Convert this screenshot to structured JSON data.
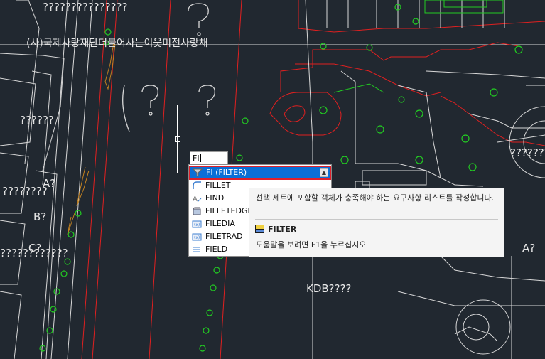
{
  "drawing": {
    "labels": {
      "top_question": "???????????????",
      "org_name": "(사)국제사랑재단더불어사는이웃미전사랑채",
      "left_q1": "??????",
      "left_a": "A?",
      "left_q2": "????????",
      "left_b": "B?",
      "left_c": "C?",
      "left_q3": "????????????",
      "right_q": "???????",
      "right_a": "A?",
      "kdb": "KDB????"
    },
    "colors": {
      "background": "#212830",
      "red": "#e02020",
      "green": "#22cc22",
      "white": "#e8e8e8",
      "orange": "#c08020"
    }
  },
  "command": {
    "input_value": "FI",
    "autocomplete": [
      {
        "label": "FI (FILTER)",
        "icon": "filter-icon",
        "selected": true
      },
      {
        "label": "FILLET",
        "icon": "fillet-icon",
        "selected": false
      },
      {
        "label": "FIND",
        "icon": "find-icon",
        "selected": false
      },
      {
        "label": "FILLETEDGE",
        "icon": "filletedge-icon",
        "selected": false
      },
      {
        "label": "FILEDIA",
        "icon": "filedia-icon",
        "selected": false
      },
      {
        "label": "FILETRAD",
        "icon": "filetrad-icon",
        "selected": false
      },
      {
        "label": "FIELD",
        "icon": "field-icon",
        "selected": false
      }
    ],
    "scroll_up_glyph": "▲"
  },
  "tooltip": {
    "description": "선택 세트에 포함할 객체가 충족해야 하는 요구사항 리스트를 작성합니다.",
    "command_name": "FILTER",
    "help_text": "도움말을 보려면 F1을 누르십시오"
  }
}
